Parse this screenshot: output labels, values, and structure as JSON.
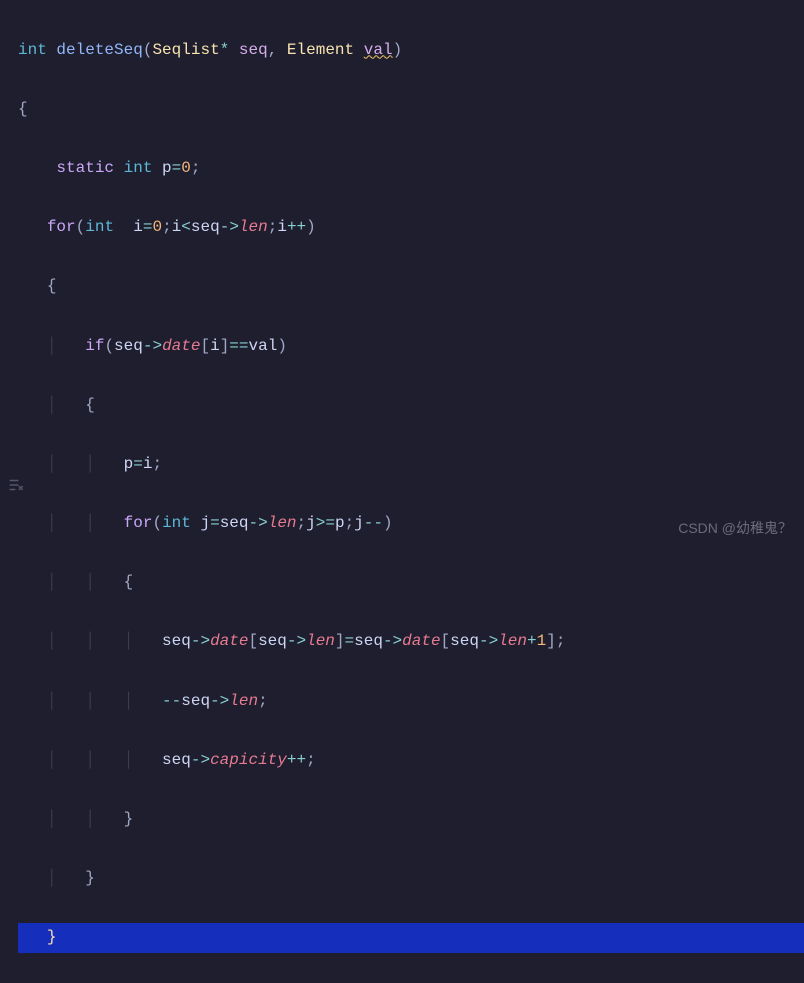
{
  "code": {
    "l1": {
      "int": "int",
      "fn": "deleteSeq",
      "type": "Seqlist",
      "star": "*",
      "p1": "seq",
      "comma": ",",
      "etype": "Element",
      "p2": "val",
      "lp": "(",
      "rp": ")"
    },
    "l2": {
      "brace": "{"
    },
    "l3": {
      "static": "static",
      "int": "int",
      "var": "p",
      "eq": "=",
      "num": "0",
      "semi": ";"
    },
    "l4": {
      "for": "for",
      "lp": "(",
      "int": "int",
      "var": "i",
      "eq": "=",
      "num": "0",
      "semi1": ";",
      "cond_var": "i",
      "lt": "<",
      "seq": "seq",
      "arrow": "->",
      "len": "len",
      "semi2": ";",
      "inc_var": "i",
      "inc": "++",
      "rp": ")"
    },
    "l5": {
      "brace": "{"
    },
    "l6": {
      "if": "if",
      "lp": "(",
      "seq": "seq",
      "arrow": "->",
      "date": "date",
      "lb": "[",
      "i": "i",
      "rb": "]",
      "eqeq": "==",
      "val": "val",
      "rp": ")"
    },
    "l7": {
      "brace": "{"
    },
    "l8": {
      "p": "p",
      "eq": "=",
      "i": "i",
      "semi": ";"
    },
    "l9": {
      "for": "for",
      "lp": "(",
      "int": "int",
      "j": "j",
      "eq": "=",
      "seq": "seq",
      "arrow": "->",
      "len": "len",
      "semi1": ";",
      "j2": "j",
      "gte": ">=",
      "p": "p",
      "semi2": ";",
      "j3": "j",
      "dec": "--",
      "rp": ")"
    },
    "l10": {
      "brace": "{"
    },
    "l11": {
      "seq1": "seq",
      "arr1": "->",
      "date1": "date",
      "lb1": "[",
      "seq2": "seq",
      "arr2": "->",
      "len1": "len",
      "rb1": "]",
      "eq": "=",
      "seq3": "seq",
      "arr3": "->",
      "date2": "date",
      "lb2": "[",
      "seq4": "seq",
      "arr4": "->",
      "len2": "len",
      "plus": "+",
      "one": "1",
      "rb2": "]",
      "semi": ";"
    },
    "l12": {
      "dec": "--",
      "seq": "seq",
      "arrow": "->",
      "len": "len",
      "semi": ";"
    },
    "l13": {
      "seq": "seq",
      "arrow": "->",
      "cap": "capicity",
      "inc": "++",
      "semi": ";"
    },
    "l14": {
      "brace": "}"
    },
    "l15": {
      "brace": "}"
    },
    "l16": {
      "brace": "}"
    }
  },
  "watermark": "CSDN @幼稚鬼？",
  "edit_icon": "edit-icon"
}
